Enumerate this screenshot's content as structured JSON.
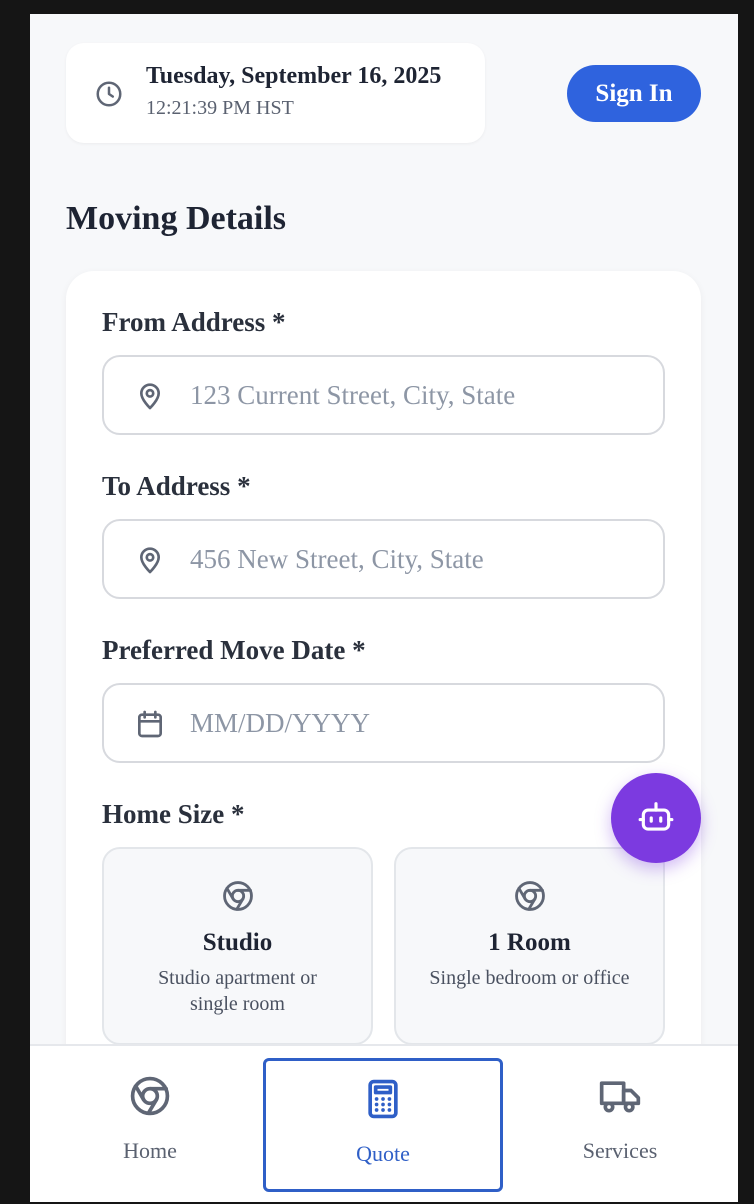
{
  "header": {
    "date": "Tuesday, September 16, 2025",
    "time": "12:21:39 PM HST",
    "signin_label": "Sign In"
  },
  "section_title": "Moving Details",
  "form": {
    "from": {
      "label": "From Address *",
      "placeholder": "123 Current Street, City, State",
      "icon": "map-pin-icon"
    },
    "to": {
      "label": "To Address *",
      "placeholder": "456 New Street, City, State",
      "icon": "map-pin-icon"
    },
    "date": {
      "label": "Preferred Move Date *",
      "placeholder": "MM/DD/YYYY",
      "icon": "calendar-icon"
    },
    "home_size": {
      "label": "Home Size *",
      "options": [
        {
          "title": "Studio",
          "desc": "Studio apartment or single room",
          "icon": "chrome-icon"
        },
        {
          "title": "1 Room",
          "desc": "Single bedroom or office",
          "icon": "chrome-icon"
        }
      ]
    }
  },
  "fab": {
    "icon": "robot-icon"
  },
  "nav": {
    "items": [
      {
        "label": "Home",
        "icon": "chrome-icon"
      },
      {
        "label": "Quote",
        "icon": "calculator-icon",
        "active": true
      },
      {
        "label": "Services",
        "icon": "truck-icon"
      }
    ]
  },
  "colors": {
    "primary": "#2f63de",
    "fab": "#7c3ae0",
    "active_nav": "#2f5fc7"
  }
}
